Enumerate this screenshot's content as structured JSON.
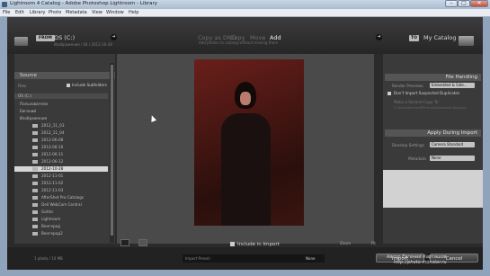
{
  "window": {
    "title": "Lightroom 4 Catalog - Adobe Photoshop Lightroom - Library",
    "minimize": "–",
    "maximize": "□",
    "close": "✕"
  },
  "menu": {
    "items": [
      "File",
      "Edit",
      "Library",
      "Photo",
      "Metadata",
      "View",
      "Window",
      "Help"
    ]
  },
  "header": {
    "from_label": "FROM",
    "source_name": "OS (C:)",
    "source_sub": "Изображения / 04 / 2012-10-28",
    "modes": [
      "Copy as DNG",
      "Copy",
      "Move",
      "Add"
    ],
    "active_mode": "Add",
    "mode_sub": "Add photos to catalog without moving them",
    "to_label": "TO",
    "destination": "My Catalog"
  },
  "left": {
    "source_title": "Source",
    "files_label": "Files",
    "include_subfolders": "Include Subfolders",
    "tree": [
      "OS (C:)",
      "Пользователи",
      "Евгений",
      "Изображения",
      "2012_11_03",
      "2012_11_04",
      "2012-06-08",
      "2012-06-10",
      "2012-06-11",
      "2012-06-12",
      "2012-10-28",
      "2012-11-01",
      "2012-11-02",
      "2012-11-03",
      "AfterShot Pro Catalogs",
      "Dell WebCam Central",
      "Gothic",
      "Lightroom",
      "Венгерод",
      "Венгерод2"
    ],
    "selected_index": 10,
    "footer": "1 photo / 10 MB"
  },
  "center": {
    "include_label": "Include in Import",
    "zoom_label": "Zoom",
    "fit_label": "Fit"
  },
  "right": {
    "file_handling": "File Handling",
    "render_previews_label": "Render Previews",
    "render_previews_value": "Embedded & Side...",
    "dont_import_dupes": "Don't Import Suspected Duplicates",
    "second_copy": "Make a Second Copy To:",
    "second_copy_path": "C:\\Users\\Евгений\\Pictures\\Download Backups",
    "apply_during_import": "Apply During Import",
    "develop_label": "Develop Settings",
    "develop_value": "Camera Standard",
    "metadata_label": "Metadata",
    "metadata_value": "None",
    "keywords_label": "Keywords"
  },
  "footer": {
    "import_label": "Import",
    "cancel_label": "Cancel",
    "preset_label": "Import Preset :",
    "preset_value": "None"
  },
  "watermark": {
    "line1": "Автор Евгений Карташов",
    "line2": "http://photo-monster.ru"
  },
  "colors": {
    "panel": "#3a3a3a",
    "header": "#262626",
    "selection": "#d6d6d6"
  }
}
